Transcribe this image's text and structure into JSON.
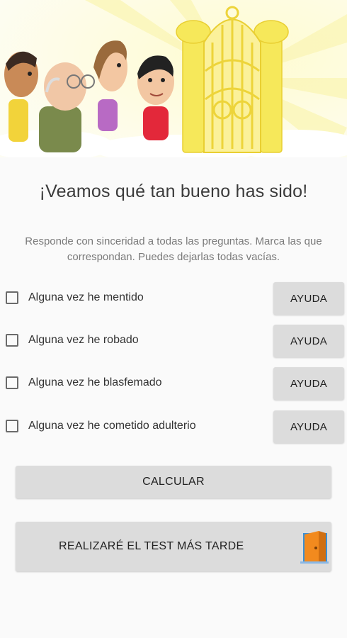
{
  "header": {
    "title": "¡Veamos qué tan bueno has sido!",
    "instructions": "Responde con sinceridad a todas las preguntas. Marca las que correspondan. Puedes dejarlas todas vacías."
  },
  "questions": [
    {
      "label": "Alguna vez he mentido",
      "checked": false,
      "help_label": "AYUDA"
    },
    {
      "label": "Alguna vez he robado",
      "checked": false,
      "help_label": "AYUDA"
    },
    {
      "label": "Alguna vez he blasfemado",
      "checked": false,
      "help_label": "AYUDA"
    },
    {
      "label": "Alguna vez he cometido adulterio",
      "checked": false,
      "help_label": "AYUDA"
    }
  ],
  "actions": {
    "calculate_label": "CALCULAR",
    "later_label": "REALIZARÉ EL TEST MÁS TARDE",
    "later_icon": "door-icon"
  },
  "colors": {
    "background": "#fafafa",
    "button": "#dcdcdc",
    "gate_yellow": "#f6e85a",
    "door_orange": "#f28a1e",
    "door_blue": "#3a8fd6"
  }
}
